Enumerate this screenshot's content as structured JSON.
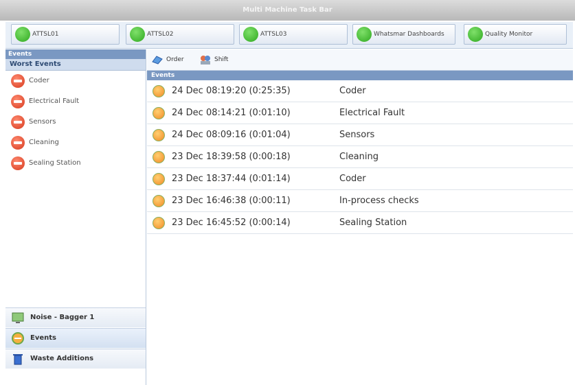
{
  "window": {
    "title": "Multi Machine Task Bar"
  },
  "machines": [
    {
      "label": "ATTSL01",
      "status_color": "#3cb82a"
    },
    {
      "label": "ATTSL02",
      "status_color": "#3cb82a"
    },
    {
      "label": "ATTSL03",
      "status_color": "#3cb82a"
    },
    {
      "label": "Whatsmar Dashboards",
      "status_color": "#3cb82a"
    },
    {
      "label": "Quality Monitor",
      "status_color": "#3cb82a"
    }
  ],
  "left_panel": {
    "header": "Events",
    "section": "Worst Events",
    "items": [
      {
        "label": "Coder",
        "icon": "stop-icon"
      },
      {
        "label": "Electrical Fault",
        "icon": "stop-icon"
      },
      {
        "label": "Sensors",
        "icon": "stop-icon"
      },
      {
        "label": "Cleaning",
        "icon": "stop-icon"
      },
      {
        "label": "Sealing Station",
        "icon": "stop-icon"
      }
    ],
    "nav": [
      {
        "label": "Noise - Bagger 1",
        "icon": "monitor-icon"
      },
      {
        "label": "Events",
        "icon": "events-icon"
      },
      {
        "label": "Waste Additions",
        "icon": "bin-icon"
      }
    ]
  },
  "toolbar": {
    "buttons": [
      {
        "label": "Order",
        "icon": "order-icon"
      },
      {
        "label": "Shift",
        "icon": "shift-icon"
      }
    ]
  },
  "events": {
    "header": "Events",
    "rows": [
      {
        "time": "24 Dec 08:19:20 (0:25:35)",
        "event": "Coder"
      },
      {
        "time": "24 Dec 08:14:21 (0:01:10)",
        "event": "Electrical Fault"
      },
      {
        "time": "24 Dec 08:09:16 (0:01:04)",
        "event": "Sensors"
      },
      {
        "time": "23 Dec 18:39:58 (0:00:18)",
        "event": "Cleaning"
      },
      {
        "time": "23 Dec 18:37:44 (0:01:14)",
        "event": "Coder"
      },
      {
        "time": "23 Dec 16:46:38 (0:00:11)",
        "event": "In-process checks"
      },
      {
        "time": "23 Dec 16:45:52 (0:00:14)",
        "event": "Sealing Station"
      }
    ]
  }
}
